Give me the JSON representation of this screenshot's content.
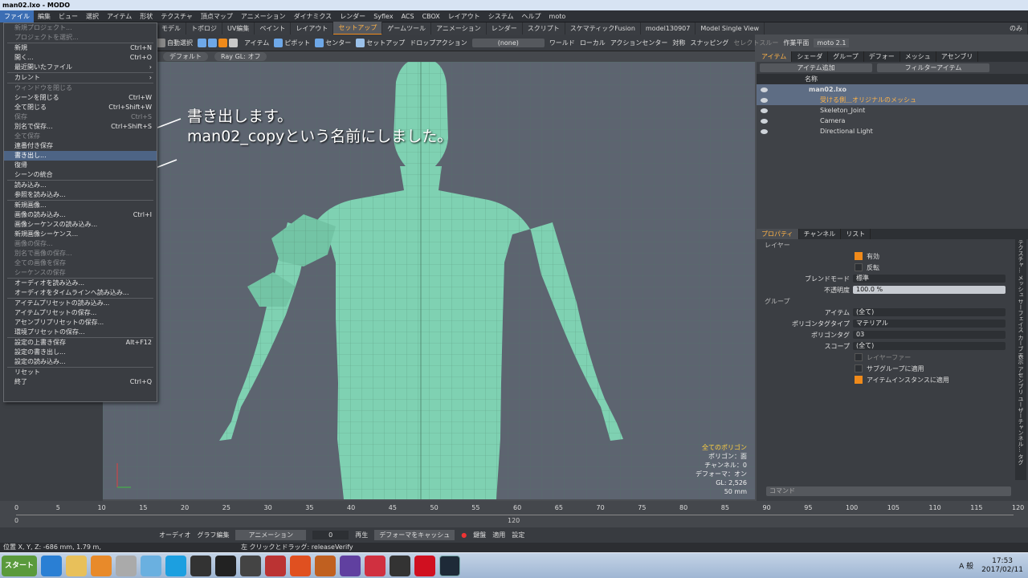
{
  "window": {
    "title": "man02.lxo - MODO"
  },
  "menubar": [
    "ファイル",
    "編集",
    "ビュー",
    "選択",
    "アイテム",
    "形状",
    "テクスチャ",
    "頂点マップ",
    "アニメーション",
    "ダイナミクス",
    "レンダー",
    "Syflex",
    "ACS",
    "CBOX",
    "レイアウト",
    "システム",
    "ヘルプ",
    "moto"
  ],
  "tabs": [
    "モデル",
    "トポロジ",
    "UV編集",
    "ペイント",
    "レイアウト",
    "セットアップ",
    "ゲームツール",
    "アニメーション",
    "レンダー",
    "スクリプト",
    "スケマティックFusion",
    "model130907",
    "Model Single View",
    "のみ"
  ],
  "active_tab": "セットアップ",
  "toolbar": {
    "auto_select": "自動選択",
    "item": "アイテム",
    "pivot": "ピボット",
    "center": "センター",
    "setup": "セットアップ",
    "drop_action": "ドロップアクション",
    "none": "(none)",
    "world": "ワールド",
    "local": "ローカル",
    "action_center": "アクションセンター",
    "symmetry": "対称",
    "snapping": "スナッピング",
    "select_through": "セレクトスルー",
    "work_plane": "作業平面",
    "moto": "moto 2.1"
  },
  "viewport": {
    "shading": "デフォルト",
    "raygl": "Ray GL: オフ",
    "hud": {
      "title": "全てのポリゴン",
      "polygons": "ポリゴン：面",
      "channels": "チャンネル：0",
      "deformers": "デフォーマ：オン",
      "gl": "GL: 2,526",
      "lens": "50 mm"
    }
  },
  "annotation": {
    "line1": "書き出します。",
    "line2": "man02_copyという名前にしました。"
  },
  "filemenu": [
    {
      "label": "新規プロジェクト...",
      "shortcut": "",
      "disabled": true
    },
    {
      "label": "プロジェクトを選択...",
      "shortcut": "",
      "disabled": true
    },
    {
      "sep": true
    },
    {
      "label": "新規",
      "shortcut": "Ctrl+N"
    },
    {
      "label": "開く...",
      "shortcut": "Ctrl+O"
    },
    {
      "label": "最近開いたファイル",
      "shortcut": "›"
    },
    {
      "sep": true
    },
    {
      "label": "カレント",
      "shortcut": "›"
    },
    {
      "sep": true
    },
    {
      "label": "ウィンドウを閉じる",
      "shortcut": "",
      "disabled": true
    },
    {
      "label": "シーンを閉じる",
      "shortcut": "Ctrl+W"
    },
    {
      "label": "全て閉じる",
      "shortcut": "Ctrl+Shift+W"
    },
    {
      "label": "保存",
      "shortcut": "Ctrl+S",
      "disabled": true
    },
    {
      "label": "別名で保存...",
      "shortcut": "Ctrl+Shift+S"
    },
    {
      "label": "全て保存",
      "shortcut": "",
      "disabled": true
    },
    {
      "label": "連番付き保存",
      "shortcut": ""
    },
    {
      "label": "書き出し...",
      "shortcut": "",
      "highlight": true
    },
    {
      "label": "復帰",
      "shortcut": ""
    },
    {
      "label": "シーンの統合",
      "shortcut": ""
    },
    {
      "sep": true
    },
    {
      "label": "読み込み...",
      "shortcut": ""
    },
    {
      "label": "参照を読み込み...",
      "shortcut": ""
    },
    {
      "sep": true
    },
    {
      "label": "新規画像...",
      "shortcut": ""
    },
    {
      "label": "画像の読み込み...",
      "shortcut": "Ctrl+I"
    },
    {
      "label": "画像シーケンスの読み込み...",
      "shortcut": ""
    },
    {
      "label": "新規画像シーケンス...",
      "shortcut": ""
    },
    {
      "label": "画像の保存...",
      "shortcut": "",
      "disabled": true
    },
    {
      "label": "別名で画像の保存...",
      "shortcut": "",
      "disabled": true
    },
    {
      "label": "全ての画像を保存",
      "shortcut": "",
      "disabled": true
    },
    {
      "label": "シーケンスの保存",
      "shortcut": "",
      "disabled": true
    },
    {
      "sep": true
    },
    {
      "label": "オーディオを読み込み...",
      "shortcut": ""
    },
    {
      "label": "オーディオをタイムラインへ読み込み...",
      "shortcut": ""
    },
    {
      "sep": true
    },
    {
      "label": "アイテムプリセットの読み込み...",
      "shortcut": ""
    },
    {
      "label": "アイテムプリセットの保存...",
      "shortcut": ""
    },
    {
      "label": "アセンブリプリセットの保存...",
      "shortcut": ""
    },
    {
      "label": "環境プリセットの保存...",
      "shortcut": ""
    },
    {
      "sep": true
    },
    {
      "label": "設定の上書き保存",
      "shortcut": "Alt+F12"
    },
    {
      "label": "設定の書き出し...",
      "shortcut": ""
    },
    {
      "label": "設定の読み込み...",
      "shortcut": ""
    },
    {
      "sep": true
    },
    {
      "label": "リセット",
      "shortcut": ""
    },
    {
      "label": "終了",
      "shortcut": "Ctrl+Q"
    }
  ],
  "items_panel": {
    "tabs": [
      "アイテム",
      "シェーダ",
      "グループ",
      "デフォー",
      "メッシュ",
      "アセンブリ"
    ],
    "add_item": "アイテム追加",
    "filter": "フィルターアイテム",
    "col_name": "名称",
    "rows": [
      {
        "name": "man02.lxo",
        "level": 0,
        "selected": true
      },
      {
        "name": "受ける側＿オリジナルのメッシュ",
        "level": 1,
        "selected": true,
        "orange": true
      },
      {
        "name": "Skeleton_Joint",
        "level": 1
      },
      {
        "name": "Camera",
        "level": 1
      },
      {
        "name": "Directional Light",
        "level": 1
      }
    ]
  },
  "props_panel": {
    "tabs": [
      "プロパティ",
      "チャンネル",
      "リスト"
    ],
    "section_layer": "レイヤー",
    "enable": "有効",
    "invert": "反転",
    "blend_label": "ブレンドモード",
    "blend_value": "標準",
    "opacity_label": "不透明度",
    "opacity_value": "100.0 %",
    "section_group": "グループ",
    "item_label": "アイテム",
    "item_value": "(全て)",
    "poly_type_label": "ポリゴンタグタイプ",
    "poly_type_value": "マテリアル",
    "poly_tag_label": "ポリゴンタグ",
    "poly_tag_value": "03",
    "scope_label": "スコープ",
    "scope_value": "(全て)",
    "layer_fur": "レイヤーファー",
    "sub_group": "サブグループに適用",
    "item_instance": "アイテムインスタンスに適用",
    "command": "コマンド",
    "side_tabs": "テクスチャ… メッシュ サーフェイス カーブ 表示 アセンブリ ユーザーチャンネル… タグ"
  },
  "timeline": {
    "ticks": [
      "0",
      "5",
      "10",
      "15",
      "20",
      "25",
      "30",
      "35",
      "40",
      "45",
      "50",
      "55",
      "60",
      "65",
      "70",
      "75",
      "80",
      "85",
      "90",
      "95",
      "100",
      "105",
      "110",
      "115",
      "120"
    ],
    "bottom_left": "0",
    "bottom_right": "120"
  },
  "transport": {
    "audio": "オーディオ",
    "graph": "グラフ編集",
    "anim": "アニメーション",
    "frame": "0",
    "play": "再生",
    "cache": "デフォーマをキャッシュ",
    "key": "鍵盤",
    "apply": "適用",
    "settings": "設定"
  },
  "status": {
    "coords": "位置 X, Y, Z:   -686 mm, 1.79 m,",
    "hint": "左 クリックとドラッグ: releaseVerify"
  },
  "taskbar": {
    "start": "スタート",
    "ime": "A 般",
    "time": "17:53",
    "date": "2017/02/11"
  }
}
